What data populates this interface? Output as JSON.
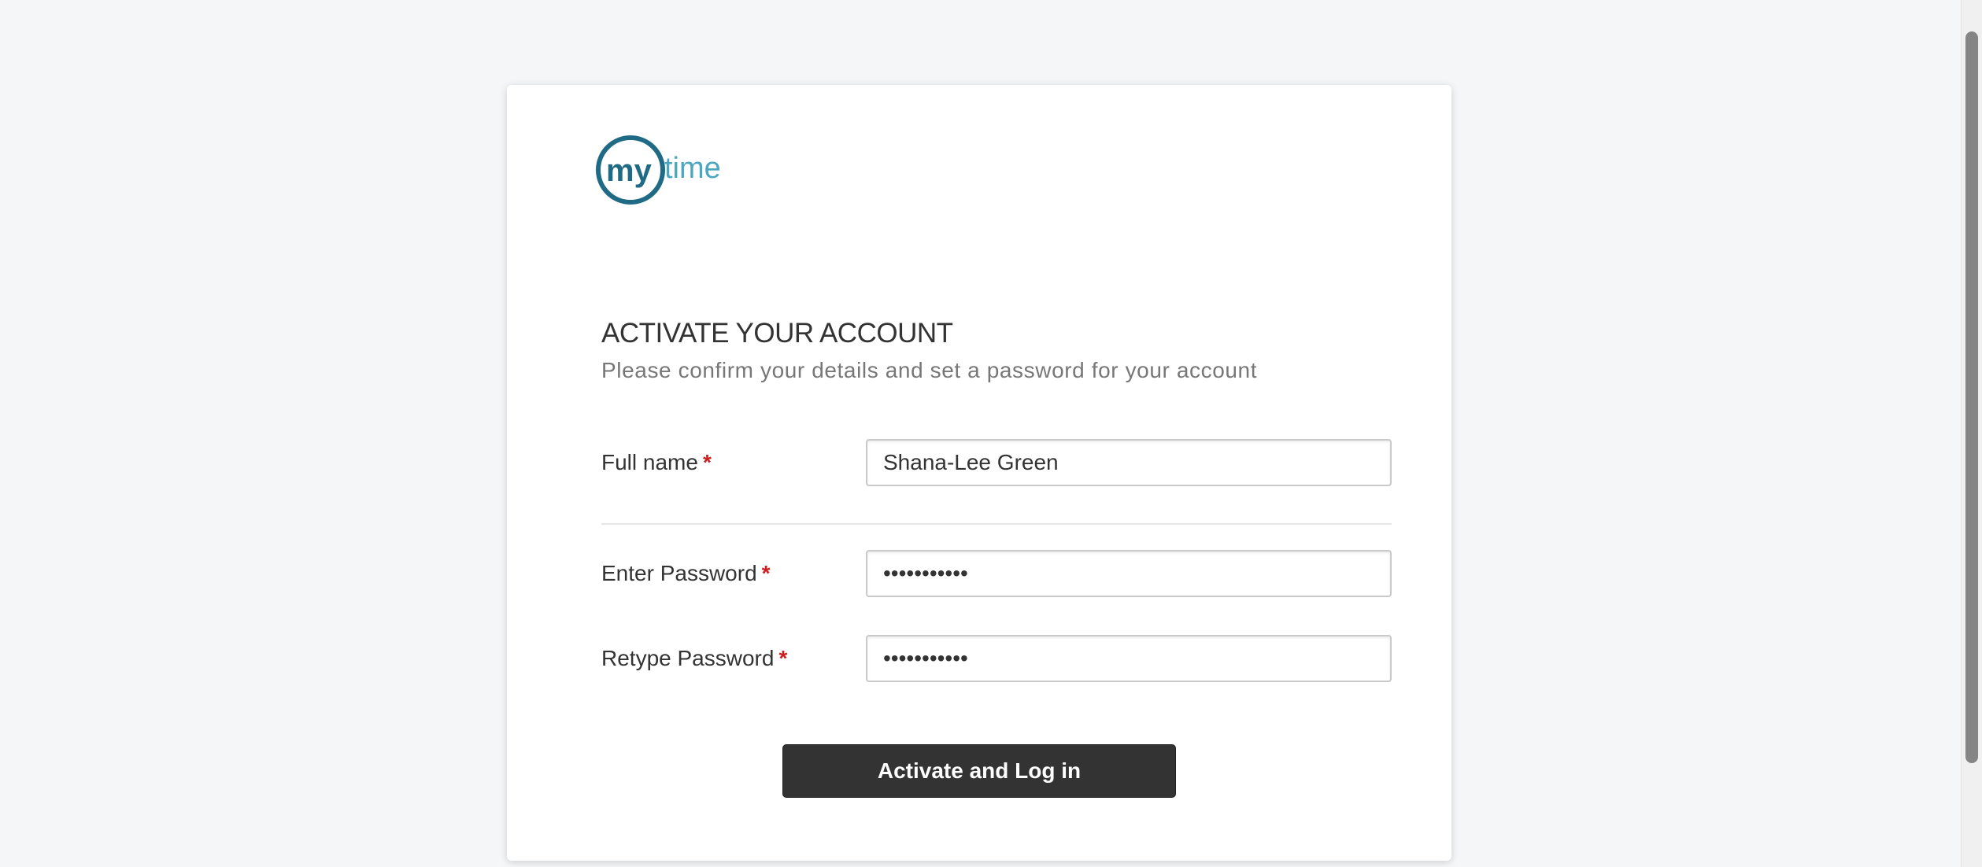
{
  "brand": {
    "logo_text": "mytime",
    "colors": {
      "dark_teal": "#1f6a85",
      "light_teal": "#4aa7bf"
    }
  },
  "form": {
    "heading": "ACTIVATE YOUR ACCOUNT",
    "subheading": "Please confirm your details and set a password for your account",
    "required_marker": "*",
    "fields": {
      "full_name": {
        "label": "Full name",
        "value": "Shana-Lee Green"
      },
      "password": {
        "label": "Enter Password",
        "value": "•••••••••••"
      },
      "retype_password": {
        "label": "Retype Password",
        "value": "•••••••••••"
      }
    },
    "submit_label": "Activate and Log in"
  },
  "theme": {
    "page_background": "#f5f6f8",
    "button_background": "#333333",
    "required_color": "#cc1f1f"
  }
}
